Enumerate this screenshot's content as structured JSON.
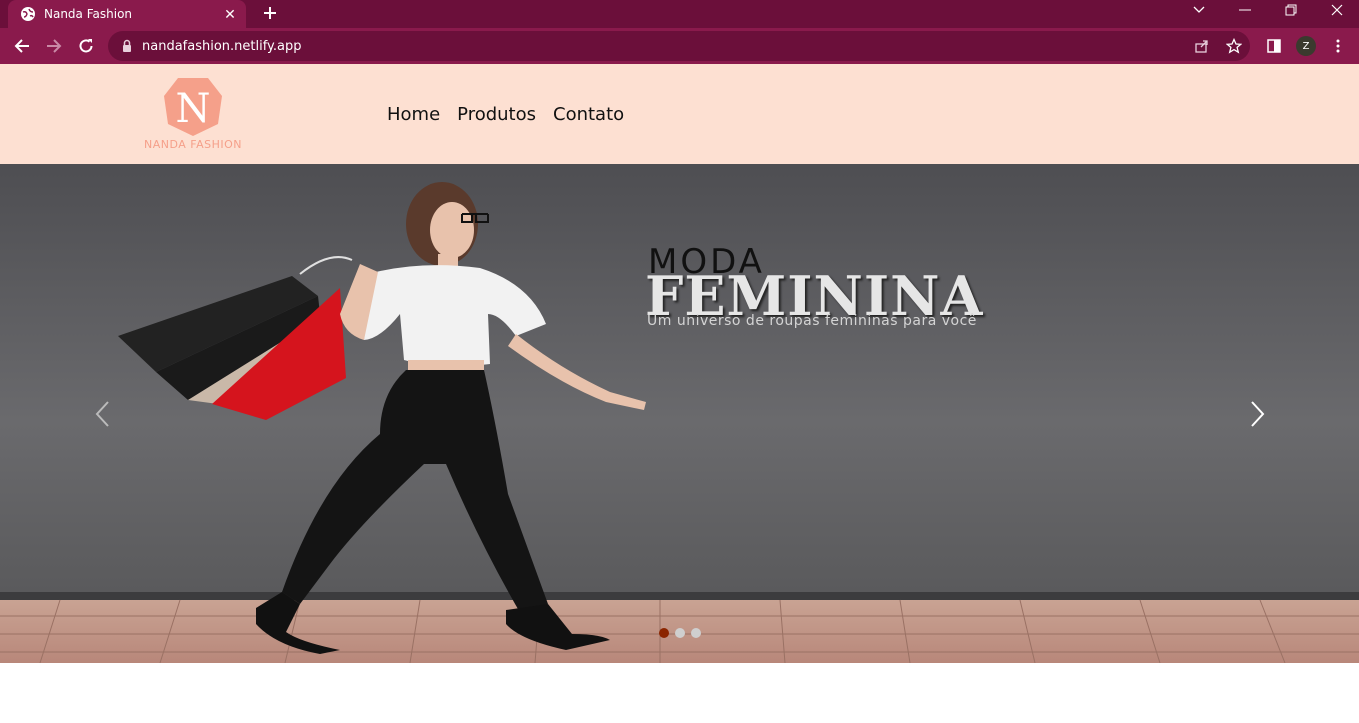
{
  "browser": {
    "tab_title": "Nanda Fashion",
    "tab_close": "✕",
    "new_tab": "+",
    "url": "nandafashion.netlify.app",
    "profile_initial": "Z"
  },
  "site": {
    "logo_letter": "N",
    "logo_text": "NANDA FASHION",
    "nav": [
      "Home",
      "Produtos",
      "Contato"
    ]
  },
  "hero": {
    "title_1": "MODA",
    "title_2": "FEMININA",
    "subtitle": "Um universo de roupas femininas para você",
    "slide_count": 3,
    "active_slide": 1
  },
  "colors": {
    "tabstrip": "#6b0f3a",
    "toolbar": "#8a1a4c",
    "header_bg": "#fde0d2",
    "logo_pink": "#f5a08a",
    "indicator_active": "#8b2500",
    "indicator_inactive": "#cfcfcf"
  },
  "icons": {
    "favicon": "globe-icon",
    "back": "arrow-left-icon",
    "forward": "arrow-right-icon",
    "reload": "reload-icon",
    "lock": "lock-icon",
    "share": "share-icon",
    "bookmark": "star-icon",
    "sidepanel": "side-panel-icon",
    "menu": "kebab-menu-icon",
    "prev": "chevron-left-icon",
    "next": "chevron-right-icon"
  }
}
